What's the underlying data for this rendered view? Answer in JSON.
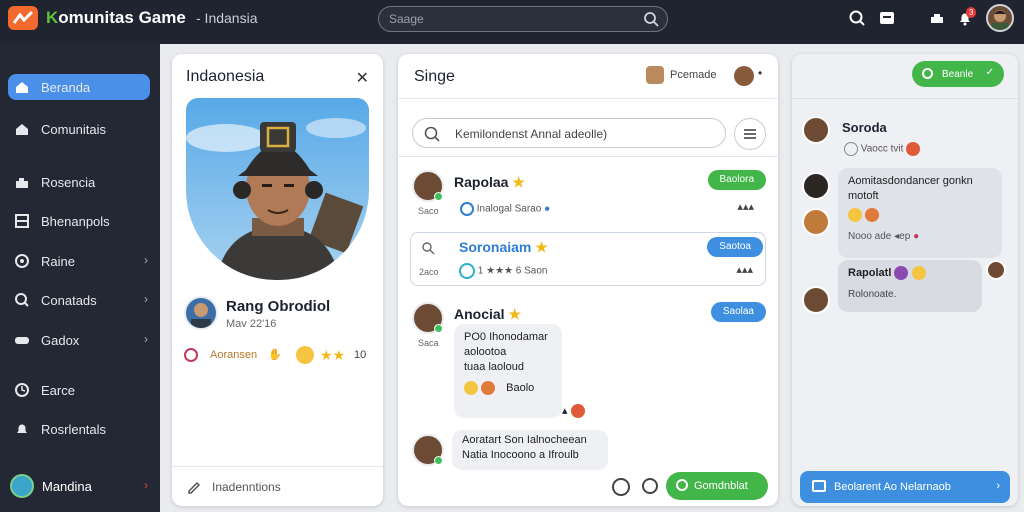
{
  "app": {
    "brand": "Komunitas Game",
    "brand_accent": "K",
    "brand_rest": "omunitas Game",
    "brand_sub": "- Indansia",
    "search_placeholder": "Saage"
  },
  "topbar": {
    "notif_badge": "3"
  },
  "sidebar": {
    "items": [
      {
        "label": "Beranda",
        "icon": "home-icon",
        "active": true
      },
      {
        "label": "Comunitais",
        "icon": "home-icon"
      },
      {
        "label": "Rosencia",
        "icon": "puzzle-icon"
      },
      {
        "label": "Bhenanpols",
        "icon": "grid-icon"
      },
      {
        "label": "Raine",
        "icon": "gamepad-icon"
      },
      {
        "label": "Conatads",
        "icon": "search-icon"
      },
      {
        "label": "Gadox",
        "icon": "controller-icon"
      },
      {
        "label": "Earce",
        "icon": "clock-icon"
      },
      {
        "label": "Rosrlentals",
        "icon": "bell-icon"
      }
    ],
    "user_label": "Mandina"
  },
  "profile_panel": {
    "title": "Indaonesia",
    "name": "Rang Obrodiol",
    "date": "Mav 22'16",
    "stat_label": "Aoransen",
    "stat_count": "10",
    "footer_label": "Inadenntions"
  },
  "feed_panel": {
    "title": "Singe",
    "header_user": "Pcemade",
    "search_placeholder": "Kemilondenst Annal adeolle)",
    "entries": [
      {
        "name": "Rapolaa",
        "sub": "Saco",
        "meta": "Inalogal  Sarao",
        "button": "Baolora",
        "button_color": "green"
      },
      {
        "name": "Soronaiam",
        "sub": "2aco",
        "meta": "1 ★★★  6  Saon",
        "button": "Saotoa",
        "button_color": "blue"
      },
      {
        "name": "Anocial",
        "sub": "Saca",
        "meta": "",
        "button": "Saolaa",
        "button_color": "blue"
      }
    ],
    "bubble1_lines": [
      "PO0 Ihonodamar",
      "aolootoa",
      "tuaa laoloud"
    ],
    "bubble1_foot": "Baolo",
    "bubble2_lines": [
      "Aoratart Son Ialnocheean",
      "Natia Inocoono a Ifroulb"
    ],
    "action_button": "Gomdnblat"
  },
  "chat_panel": {
    "top_button": "Beanle",
    "user1_name": "Soroda",
    "user1_status": "Vaocc tvit",
    "bubble1_lines": [
      "Aomitasdondancer gonkn",
      "motoft"
    ],
    "reaction_line": "Nooo ade ◂ep",
    "user2_bubble_title": "Rapolatl",
    "user2_bubble_body": "Rolonoate.",
    "footer_button": "Beolarent Ao Nelarnaob"
  },
  "colors": {
    "accent_green": "#43b649",
    "accent_blue": "#3f8fe0",
    "brand_orange": "#f26a2e",
    "topbar_bg": "#1f2430",
    "sidebar_bg": "#232834"
  }
}
